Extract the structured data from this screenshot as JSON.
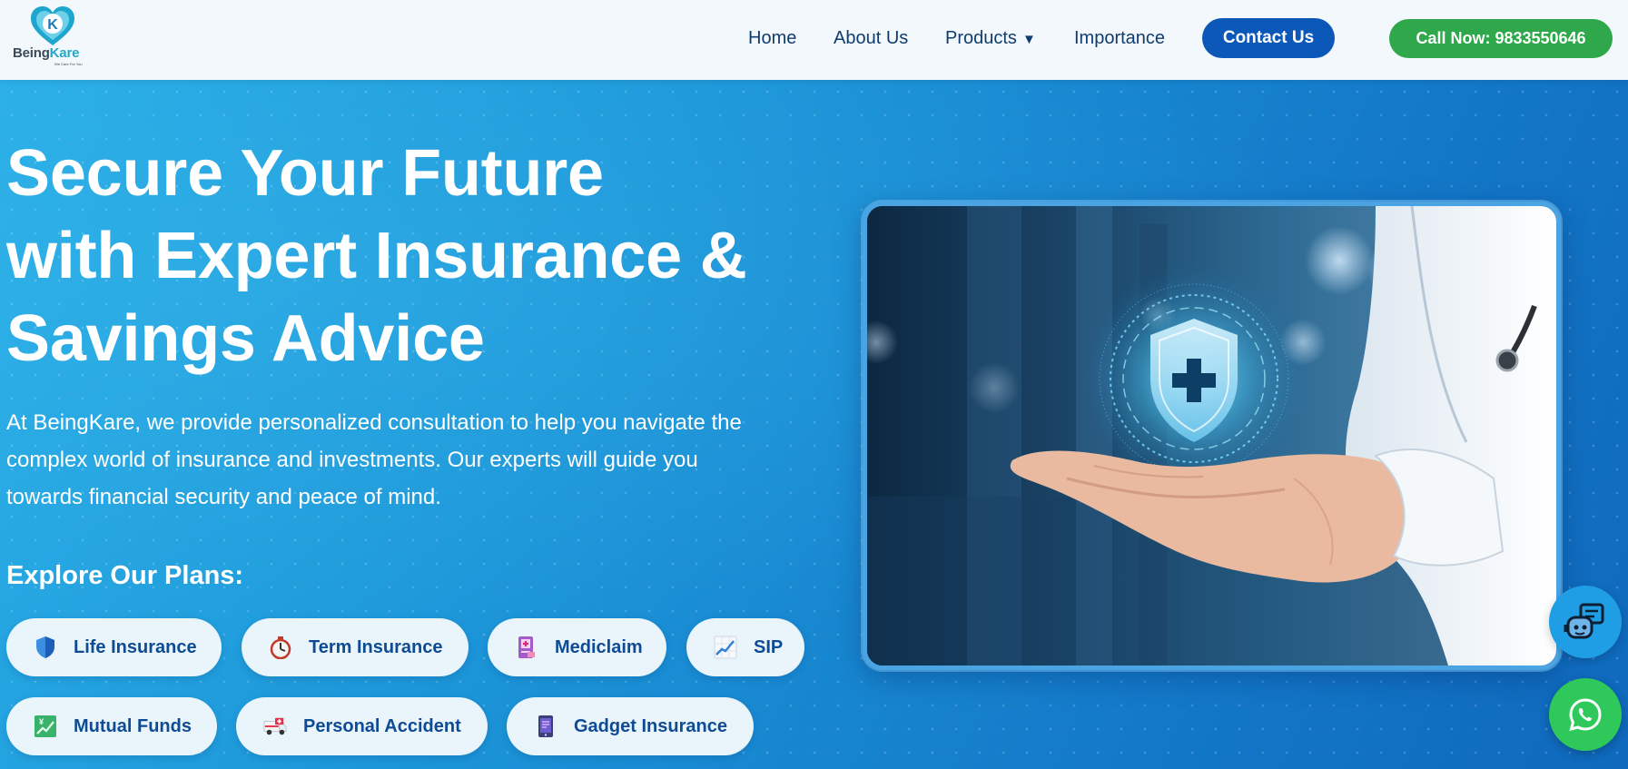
{
  "brand": {
    "name_part1": "Being",
    "name_part2": "Kare",
    "tagline": "We Care For You"
  },
  "nav": {
    "home": "Home",
    "about": "About Us",
    "products": "Products",
    "importance": "Importance",
    "contact": "Contact Us",
    "call": "Call Now: 9833550646"
  },
  "hero": {
    "title_line1": "Secure Your Future",
    "title_line2": "with Expert Insurance &",
    "title_line3": "Savings Advice",
    "description": "At BeingKare, we provide personalized consultation to help you navigate the complex world of insurance and investments. Our experts will guide you towards financial security and peace of mind.",
    "plans_heading": "Explore Our Plans:"
  },
  "plans": [
    {
      "label": "Life Insurance",
      "icon": "shield-icon"
    },
    {
      "label": "Term Insurance",
      "icon": "stopwatch-icon"
    },
    {
      "label": "Mediclaim",
      "icon": "medical-record-icon"
    },
    {
      "label": "SIP",
      "icon": "growth-chart-icon"
    },
    {
      "label": "Mutual Funds",
      "icon": "money-chart-icon"
    },
    {
      "label": "Personal Accident",
      "icon": "ambulance-icon"
    },
    {
      "label": "Gadget Insurance",
      "icon": "smartphone-icon"
    }
  ],
  "colors": {
    "primary_button": "#0b58b8",
    "call_button": "#2ea84a",
    "hero_blue": "#1b93d7",
    "pill_text": "#0e4b95",
    "whatsapp": "#2ec95a"
  }
}
